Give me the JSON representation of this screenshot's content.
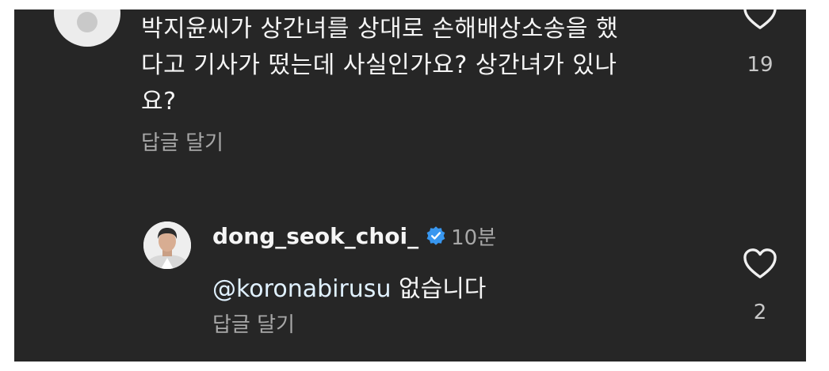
{
  "comment": {
    "text_lines": [
      "박지윤씨가 상간녀를 상대로 손해배상소송을 했",
      "다고 기사가 떴는데 사실인가요? 상간녀가 있나",
      "요?"
    ],
    "reply_label": "답글 달기",
    "like_count": "19"
  },
  "reply": {
    "username": "dong_seok_choi_",
    "timestamp": "10분",
    "mention": "@koronabirusu",
    "text": " 없습니다",
    "reply_label": "답글 달기",
    "like_count": "2"
  },
  "icons": {
    "heart": "heart-icon",
    "verified": "verified-badge-icon",
    "avatar": "avatar"
  },
  "colors": {
    "background": "#262626",
    "verified_blue": "#3897f0",
    "secondary_text": "#a8a8a8"
  }
}
